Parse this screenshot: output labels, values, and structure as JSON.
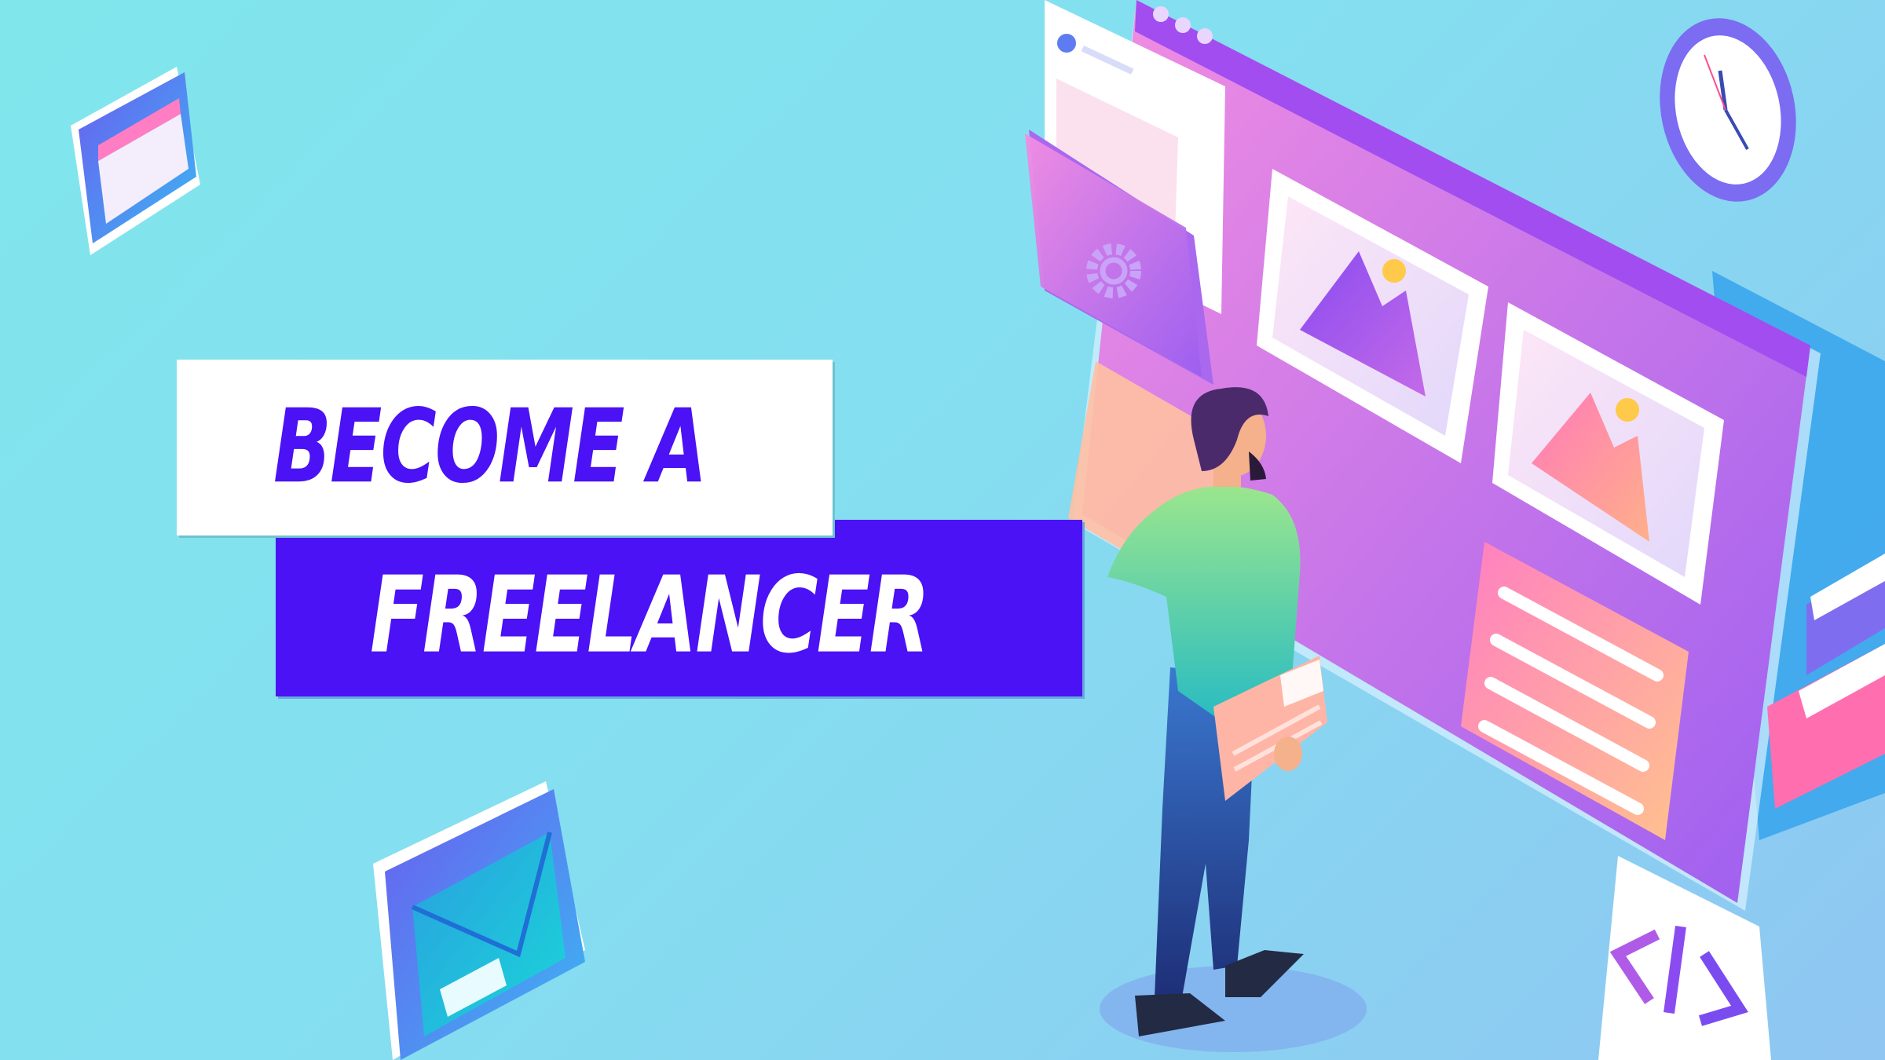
{
  "headline": {
    "line1": "BECOME A",
    "line2": "FREELANCER"
  },
  "colors": {
    "background": "#80e6ec",
    "accent": "#4a12f4",
    "board": "#b468ee",
    "text_light": "#ffffff"
  },
  "illustration": {
    "icons": [
      "calendar-icon",
      "browser-board",
      "image-card-icon",
      "gear-icon",
      "folder-icon",
      "clock-icon",
      "envelope-icon",
      "code-icon",
      "book-icon",
      "tablet-icon"
    ],
    "figure": "man-standing-with-tablet"
  }
}
